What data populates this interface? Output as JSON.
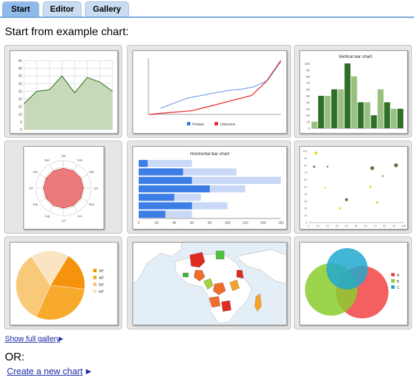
{
  "tabs": [
    {
      "label": "Start",
      "active": true
    },
    {
      "label": "Editor",
      "active": false
    },
    {
      "label": "Gallery",
      "active": false
    }
  ],
  "heading": "Start from example chart:",
  "gallery": {
    "show_full_label": "Show full gallery",
    "arrow": "►"
  },
  "or_label": "OR:",
  "create_new_label": "Create a new chart",
  "create_arrow": "►",
  "charts": {
    "area": {
      "y_ticks": [
        "45",
        "40",
        "35",
        "30",
        "25",
        "20",
        "15",
        "10",
        "5",
        "0"
      ],
      "values": [
        17,
        25,
        26,
        35,
        24,
        34,
        31,
        25
      ],
      "ymax": 45,
      "fill": "#c7d9b8",
      "line": "#3a7a2c"
    },
    "line": {
      "series": [
        {
          "name": "Ponies",
          "color": "#3c78d8",
          "dashed": true,
          "values": [
            5,
            9,
            13,
            15,
            17,
            19,
            20,
            22,
            27,
            42
          ]
        },
        {
          "name": "Unicorns",
          "color": "#e8282b",
          "dashed": false,
          "values": [
            0,
            1,
            2,
            3,
            6,
            9,
            12,
            15,
            26,
            43
          ]
        }
      ],
      "ymax": 45
    },
    "vbar": {
      "title": "Vertical bar chart",
      "y_ticks": [
        "100",
        "90",
        "80",
        "70",
        "60",
        "50",
        "40",
        "30",
        "20",
        "10",
        "0"
      ],
      "values": [
        10,
        50,
        50,
        60,
        60,
        100,
        80,
        40,
        40,
        20,
        60,
        40,
        30,
        30
      ],
      "colors": [
        "#98c07e",
        "#2f6e27"
      ]
    },
    "radar": {
      "labels": [
        "Jan",
        "Feb",
        "Mar",
        "Apr",
        "May",
        "Jun",
        "Jul",
        "Aug",
        "Sep",
        "Oct",
        "Nov",
        "Dec"
      ],
      "value": 0.72,
      "fill": "#ea6b6b",
      "stroke": "#c0392b"
    },
    "hbar": {
      "title": "Horizontal bar chart",
      "x_ticks": [
        "0",
        "20",
        "40",
        "60",
        "80",
        "100",
        "120",
        "140",
        "160"
      ],
      "xmax": 160,
      "series1": [
        10,
        50,
        60,
        80,
        40,
        60,
        30
      ],
      "series2": [
        60,
        110,
        160,
        120,
        70,
        100,
        60
      ],
      "color1": "#3d7ee6",
      "color2": "#c9d8f7"
    },
    "scatter": {
      "x_ticks": [
        "0",
        "10",
        "20",
        "30",
        "40",
        "50",
        "60",
        "70",
        "80",
        "90",
        "100"
      ],
      "y_ticks": [
        "100",
        "90",
        "80",
        "70",
        "60",
        "50",
        "40",
        "30",
        "20",
        "10",
        "0"
      ],
      "points": [
        {
          "x": 8,
          "y": 97,
          "s": 2.4,
          "c": "#e5de34"
        },
        {
          "x": 6,
          "y": 78,
          "s": 1.6,
          "c": "#7a6a3a"
        },
        {
          "x": 20,
          "y": 78,
          "s": 1.2,
          "c": "#7a6a3a"
        },
        {
          "x": 67,
          "y": 76,
          "s": 2.8,
          "c": "#7a6a3a"
        },
        {
          "x": 92,
          "y": 80,
          "s": 2.8,
          "c": "#6a6a3a"
        },
        {
          "x": 78,
          "y": 65,
          "s": 1.2,
          "c": "#7a6a3a"
        },
        {
          "x": 18,
          "y": 49,
          "s": 1.4,
          "c": "#e5de34"
        },
        {
          "x": 65,
          "y": 50,
          "s": 1.8,
          "c": "#e5de34"
        },
        {
          "x": 40,
          "y": 32,
          "s": 2.2,
          "c": "#6a6a3a"
        },
        {
          "x": 72,
          "y": 28,
          "s": 1.8,
          "c": "#e5de34"
        },
        {
          "x": 33,
          "y": 20,
          "s": 1.6,
          "c": "#e5de34"
        }
      ]
    },
    "pie": {
      "slices": [
        {
          "label": "30°",
          "value": 18,
          "color": "#f5940c"
        },
        {
          "label": "40°",
          "value": 30,
          "color": "#f7aa2c"
        },
        {
          "label": "50°",
          "value": 34,
          "color": "#f9c97a"
        },
        {
          "label": "60°",
          "value": 18,
          "color": "#fbe4c2"
        }
      ]
    },
    "map": {
      "sea": "#e4eef7",
      "land": "#ffffff",
      "colors": [
        "#e02b20",
        "#f06c2a",
        "#f5a22b",
        "#a5d23a",
        "#4cc23c",
        "#35b33a"
      ]
    },
    "venn": {
      "legend": [
        "A",
        "B",
        "C"
      ],
      "colors": [
        "#f24444",
        "#8ccc2e",
        "#22a8cf"
      ]
    }
  }
}
